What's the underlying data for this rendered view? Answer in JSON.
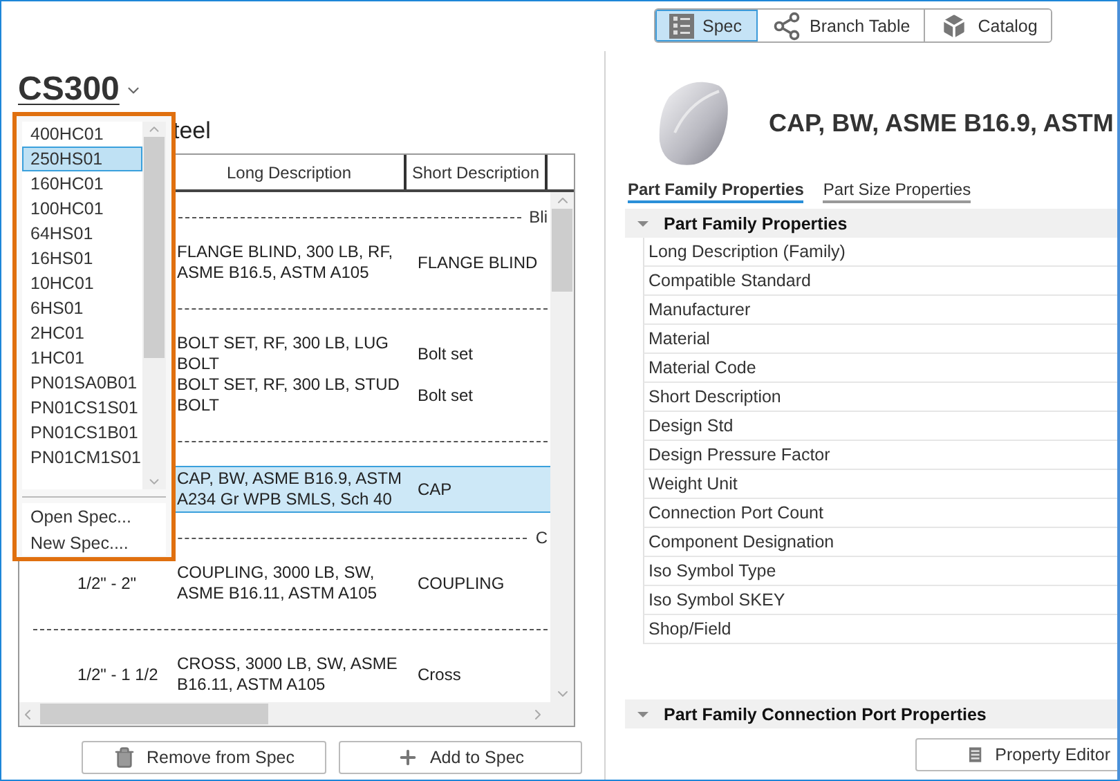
{
  "view_switcher": [
    {
      "label": "Spec",
      "selected": true
    },
    {
      "label": "Branch Table",
      "selected": false
    },
    {
      "label": "Catalog",
      "selected": false
    }
  ],
  "spec": {
    "name": "CS300",
    "description": "teel"
  },
  "spec_dropdown": {
    "items": [
      {
        "label": "400HC01",
        "selected": false
      },
      {
        "label": "250HS01",
        "selected": true
      },
      {
        "label": "160HC01",
        "selected": false
      },
      {
        "label": "100HC01",
        "selected": false
      },
      {
        "label": "64HS01",
        "selected": false
      },
      {
        "label": "16HS01",
        "selected": false
      },
      {
        "label": "10HC01",
        "selected": false
      },
      {
        "label": "6HS01",
        "selected": false
      },
      {
        "label": "2HC01",
        "selected": false
      },
      {
        "label": "1HC01",
        "selected": false
      },
      {
        "label": "PN01SA0B01",
        "selected": false
      },
      {
        "label": "PN01CS1S01",
        "selected": false
      },
      {
        "label": "PN01CS1B01",
        "selected": false
      },
      {
        "label": "PN01CM1S01",
        "selected": false
      }
    ],
    "actions": [
      "Open Spec...",
      "New Spec...."
    ]
  },
  "parts_table": {
    "columns": [
      "Long Description",
      "Short Description"
    ],
    "rows": [
      {
        "kind": "group",
        "label": "Bli"
      },
      {
        "kind": "part",
        "long": "FLANGE BLIND, 300 LB, RF, ASME B16.5, ASTM A105",
        "short": "FLANGE BLIND",
        "selected": false
      },
      {
        "kind": "group"
      },
      {
        "kind": "part",
        "long": "BOLT SET, RF, 300 LB, LUG BOLT",
        "short": "Bolt set",
        "selected": false
      },
      {
        "kind": "part",
        "long": "BOLT SET, RF, 300 LB, STUD BOLT",
        "short": "Bolt set",
        "selected": false
      },
      {
        "kind": "group"
      },
      {
        "kind": "part",
        "long": "CAP, BW, ASME B16.9, ASTM A234 Gr WPB SMLS, Sch 40",
        "short": "CAP",
        "selected": true
      },
      {
        "kind": "group",
        "label": "C"
      },
      {
        "kind": "part",
        "size": "1/2\" - 2\"",
        "long": "COUPLING, 3000 LB, SW, ASME B16.11, ASTM A105",
        "short": "COUPLING",
        "selected": false
      },
      {
        "kind": "group"
      },
      {
        "kind": "part",
        "size": "1/2\" - 1 1/2",
        "long": "CROSS, 3000 LB, SW, ASME B16.11, ASTM A105",
        "short": "Cross",
        "selected": false
      }
    ]
  },
  "remove_button": "Remove from Spec",
  "add_button": "Add to Spec",
  "detail": {
    "title": "CAP, BW, ASME B16.9, ASTM",
    "tabs": [
      {
        "label": "Part Family Properties",
        "selected": true
      },
      {
        "label": "Part Size Properties",
        "selected": false
      }
    ],
    "groups": [
      {
        "title": "Part Family Properties",
        "expanded": true,
        "properties": [
          "Long Description (Family)",
          "Compatible Standard",
          "Manufacturer",
          "Material",
          "Material Code",
          "Short Description",
          "Design Std",
          "Design Pressure Factor",
          "Weight Unit",
          "Connection Port Count",
          "Component Designation",
          "Iso Symbol Type",
          "Iso Symbol SKEY",
          "Shop/Field"
        ]
      },
      {
        "title": "Part Family Connection Port Properties",
        "expanded": true
      }
    ],
    "property_editor": "Property Editor"
  }
}
